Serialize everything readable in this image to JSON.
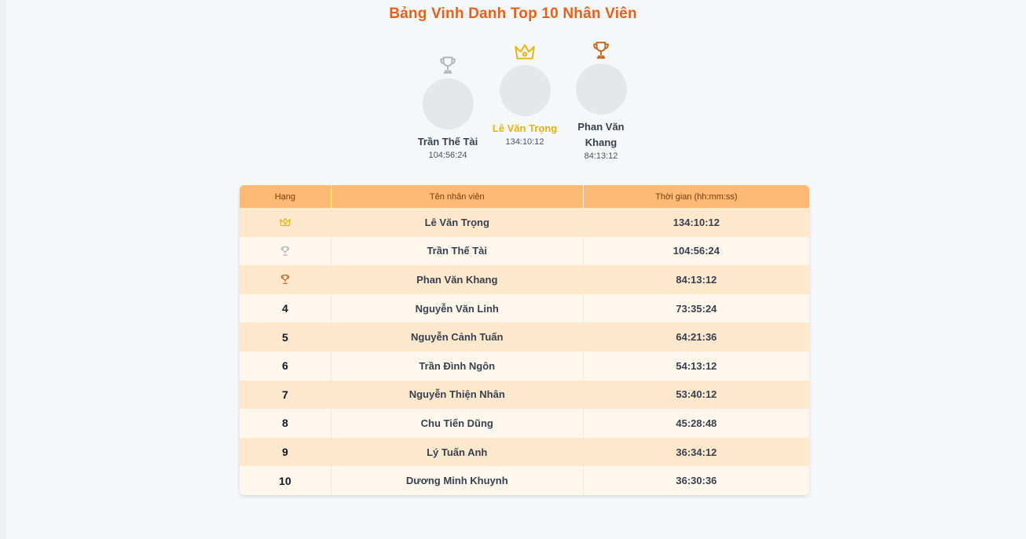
{
  "title": "Bảng Vinh Danh Top 10 Nhân Viên",
  "colors": {
    "gold": "#eab308",
    "silver": "#b0b6bf",
    "bronze": "#c2691d",
    "accent": "#e8611a",
    "header": "#fdba74"
  },
  "podium": [
    {
      "place": 2,
      "icon": "silver-trophy-icon",
      "name": "Trần Thế Tài",
      "time": "104:56:24"
    },
    {
      "place": 1,
      "icon": "gold-crown-icon",
      "name": "Lê Văn Trọng",
      "time": "134:10:12"
    },
    {
      "place": 3,
      "icon": "bronze-trophy-icon",
      "name": "Phan Văn Khang",
      "time": "84:13:12"
    }
  ],
  "table": {
    "headers": [
      "Hạng",
      "Tên nhân viên",
      "Thời gian (hh:mm:ss)"
    ],
    "rows": [
      {
        "rank": "",
        "icon": "gold-crown-icon",
        "name": "Lê Văn Trọng",
        "time": "134:10:12"
      },
      {
        "rank": "",
        "icon": "silver-trophy-icon",
        "name": "Trần Thế Tài",
        "time": "104:56:24"
      },
      {
        "rank": "",
        "icon": "bronze-trophy-icon",
        "name": "Phan Văn Khang",
        "time": "84:13:12"
      },
      {
        "rank": "4",
        "name": "Nguyễn Văn Linh",
        "time": "73:35:24"
      },
      {
        "rank": "5",
        "name": "Nguyễn Cảnh Tuấn",
        "time": "64:21:36"
      },
      {
        "rank": "6",
        "name": "Trần Đình Ngôn",
        "time": "54:13:12"
      },
      {
        "rank": "7",
        "name": "Nguyễn Thiện Nhân",
        "time": "53:40:12"
      },
      {
        "rank": "8",
        "name": "Chu Tiến Dũng",
        "time": "45:28:48"
      },
      {
        "rank": "9",
        "name": "Lý Tuấn Anh",
        "time": "36:34:12"
      },
      {
        "rank": "10",
        "name": "Dương Minh Khuynh",
        "time": "36:30:36"
      }
    ]
  }
}
